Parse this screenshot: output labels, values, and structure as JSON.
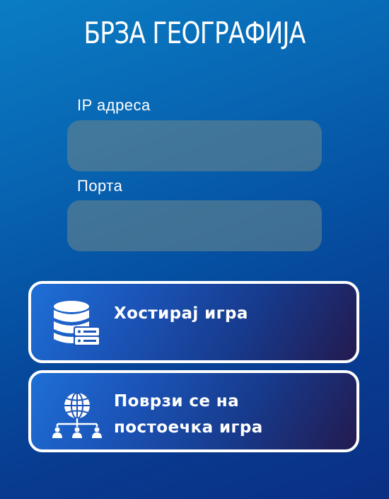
{
  "app": {
    "title": "БРЗА ГЕОГРАФИЈА"
  },
  "form": {
    "ip_label": "IP адреса",
    "ip_value": "",
    "port_label": "Порта",
    "port_value": ""
  },
  "buttons": {
    "host": {
      "label": "Хостирај игра",
      "icon": "database-server-icon"
    },
    "join": {
      "label_line1": "Поврзи се на",
      "label_line2": "постоечка игра",
      "icon": "network-globe-icon"
    }
  },
  "colors": {
    "background_top": "#0a7dc4",
    "background_bottom": "#0a2f83",
    "input_fill": "#64828c",
    "button_border": "#ffffff"
  }
}
